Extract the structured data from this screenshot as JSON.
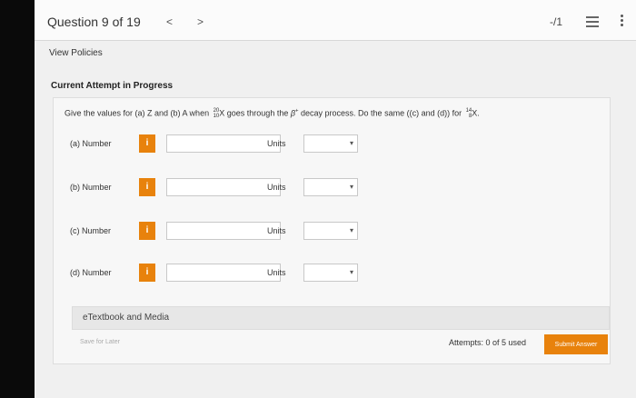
{
  "header": {
    "question_label": "Question 9 of 19",
    "prev": "<",
    "next": ">",
    "score": "-/1"
  },
  "view_policies": "View Policies",
  "current_attempt": "Current Attempt in Progress",
  "question": {
    "part1": "Give the values for (a) Z and (b) A when ",
    "nuclide1_mass": "20",
    "nuclide1_atomic": "10",
    "nuclide1_symbol": "X",
    "part2": " goes through the ",
    "beta": "β",
    "beta_charge": "+",
    "part3": " decay process. Do the same ((c) and (d)) for ",
    "nuclide2_mass": "14",
    "nuclide2_atomic": "8",
    "nuclide2_symbol": "X."
  },
  "rows": [
    {
      "label": "(a)   Number",
      "info": "i",
      "units_label": "Units"
    },
    {
      "label": "(b)   Number",
      "info": "i",
      "units_label": "Units"
    },
    {
      "label": "(c)   Number",
      "info": "i",
      "units_label": "Units"
    },
    {
      "label": "(d)   Number",
      "info": "i",
      "units_label": "Units"
    }
  ],
  "etextbook": "eTextbook and Media",
  "save_for_later": "Save for Later",
  "attempts": "Attempts: 0 of 5 used",
  "submit": "Submit Answer",
  "colors": {
    "accent": "#e8820c"
  }
}
